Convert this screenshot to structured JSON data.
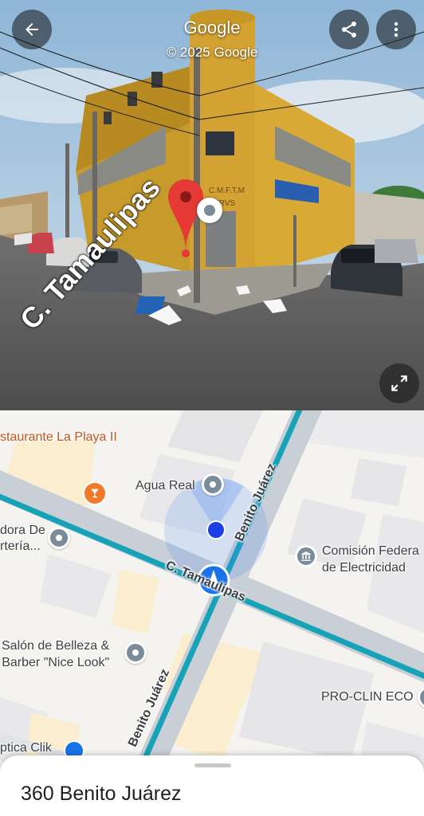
{
  "header": {
    "title": "Google",
    "copyright": "© 2025 Google",
    "back_icon": "arrow-back-icon",
    "share_icon": "share-icon",
    "more_icon": "more-vert-icon"
  },
  "street_view": {
    "street_label": "C. Tamaulipas",
    "expand_icon": "fullscreen-icon",
    "pin_icon": "location-pin-icon",
    "pin_color": "#e53935",
    "building_sign": "CMFTM ERVS"
  },
  "map": {
    "places": [
      {
        "name": "staurante La Playa II",
        "icon": "restaurant-pin-icon"
      },
      {
        "name": "Agua Real",
        "icon": "place-pin-icon"
      },
      {
        "name": "dora De\nrtería...",
        "icon": "place-pin-icon"
      },
      {
        "name": "Comisión Federa\nde Electricidad",
        "icon": "government-icon"
      },
      {
        "name": "Salón de Belleza &\nBarber \"Nice Look\"",
        "icon": "place-pin-icon"
      },
      {
        "name": "PRO-CLIN ECO",
        "icon": "place-pin-icon"
      },
      {
        "name": "ptica Clik",
        "icon": "shop-pin-icon"
      }
    ],
    "roads": {
      "benito_top": "Benito Juárez",
      "benito_bottom": "Benito Juárez",
      "tamaulipas": "C. Tamaulipas"
    },
    "colors": {
      "road_highlight": "#17a2b8",
      "location_dot": "#1a3ee8",
      "accent": "#1a73e8"
    }
  },
  "sheet": {
    "address": "360 Benito Juárez"
  }
}
